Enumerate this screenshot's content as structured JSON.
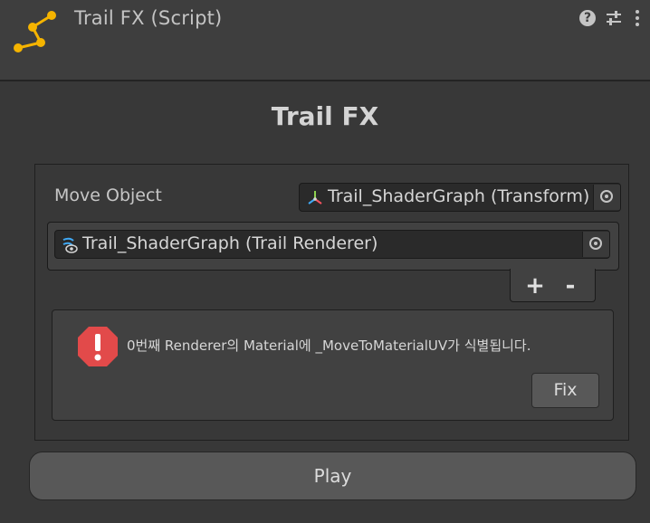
{
  "header": {
    "title": "Trail FX (Script)",
    "script_icon": "trail-script-icon",
    "help_icon": "help-icon",
    "presets_icon": "presets-sliders-icon",
    "menu_icon": "kebab-menu-icon"
  },
  "main": {
    "title": "Trail FX"
  },
  "move_object": {
    "label": "Move Object",
    "value": "Trail_ShaderGraph (Transform)",
    "icon": "transform-icon"
  },
  "renderer_list": {
    "items": [
      {
        "value": "Trail_ShaderGraph (Trail Renderer)",
        "icon": "trail-renderer-icon"
      }
    ],
    "add_label": "+",
    "remove_label": "-"
  },
  "help_box": {
    "type": "error",
    "message": "0번째 Renderer의 Material에 _MoveToMaterialUV가 식별됩니다.",
    "fix_label": "Fix"
  },
  "play_label": "Play",
  "colors": {
    "accent_yellow": "#f5b400",
    "error_red": "#e24a4a"
  }
}
